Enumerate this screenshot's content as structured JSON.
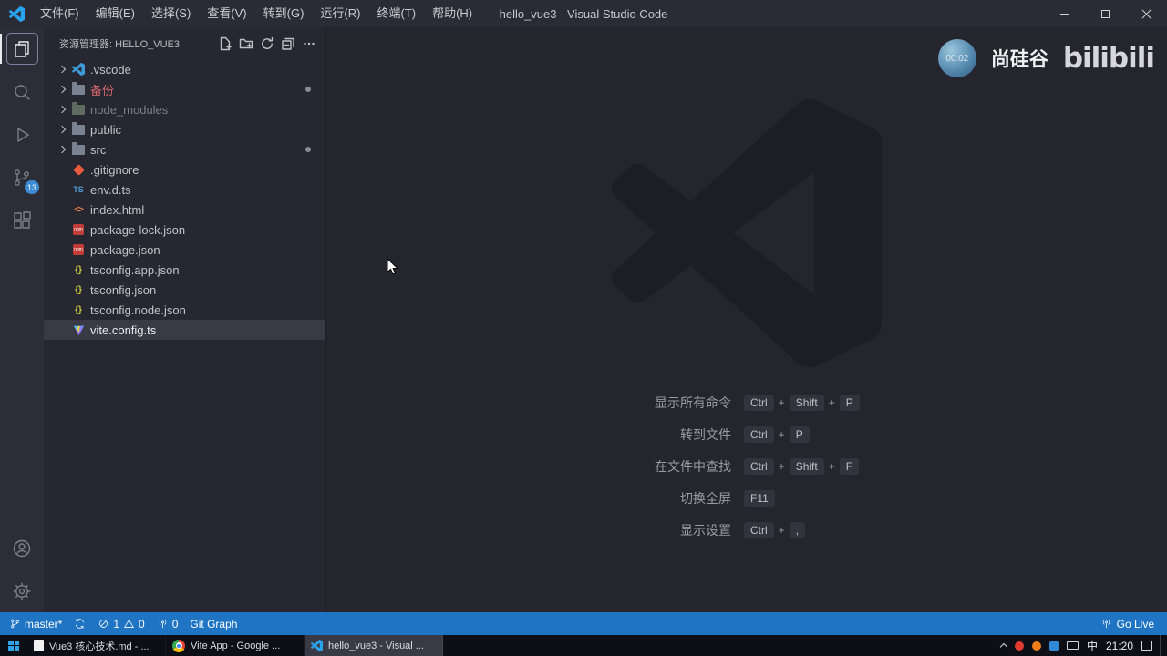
{
  "title_bar": {
    "app_title": "hello_vue3 - Visual Studio Code",
    "menus": [
      "文件(F)",
      "编辑(E)",
      "选择(S)",
      "查看(V)",
      "转到(G)",
      "运行(R)",
      "终端(T)",
      "帮助(H)"
    ]
  },
  "activity_bar": {
    "source_control_badge": "13"
  },
  "explorer": {
    "header": "资源管理器: HELLO_VUE3",
    "items": [
      {
        "label": ".vscode"
      },
      {
        "label": "备份"
      },
      {
        "label": "node_modules"
      },
      {
        "label": "public"
      },
      {
        "label": "src"
      },
      {
        "label": ".gitignore"
      },
      {
        "label": "env.d.ts"
      },
      {
        "label": "index.html"
      },
      {
        "label": "package-lock.json"
      },
      {
        "label": "package.json"
      },
      {
        "label": "tsconfig.app.json"
      },
      {
        "label": "tsconfig.json"
      },
      {
        "label": "tsconfig.node.json"
      },
      {
        "label": "vite.config.ts"
      }
    ],
    "npm_icon_text": "npm",
    "ts_icon_text": "TS",
    "html_icon_text": "<>",
    "json_icon_text": "{}"
  },
  "editor": {
    "key_separator": "+",
    "shortcuts": [
      {
        "label": "显示所有命令",
        "keys": [
          "Ctrl",
          "Shift",
          "P"
        ]
      },
      {
        "label": "转到文件",
        "keys": [
          "Ctrl",
          "P"
        ]
      },
      {
        "label": "在文件中查找",
        "keys": [
          "Ctrl",
          "Shift",
          "F"
        ]
      },
      {
        "label": "切换全屏",
        "keys": [
          "F11"
        ]
      },
      {
        "label": "显示设置",
        "keys": [
          "Ctrl",
          ","
        ]
      }
    ]
  },
  "overlay": {
    "badge_text": "00:02",
    "brand_left": "尚硅谷",
    "brand_right": "bilibili"
  },
  "status_bar": {
    "branch": "master*",
    "errors": "1",
    "warnings": "0",
    "ports": "0",
    "git_graph": "Git Graph",
    "go_live": "Go Live"
  },
  "taskbar": {
    "apps": [
      {
        "label": "Vue3 核心技术.md - ..."
      },
      {
        "label": "Vite App - Google ..."
      },
      {
        "label": "hello_vue3 - Visual ..."
      }
    ],
    "ime": "中",
    "clock": "21:20"
  },
  "colors": {
    "status_bar": "#1f74c4",
    "vscode_blue": "#2aa3ef",
    "badge_blue": "#3d8bd4"
  }
}
